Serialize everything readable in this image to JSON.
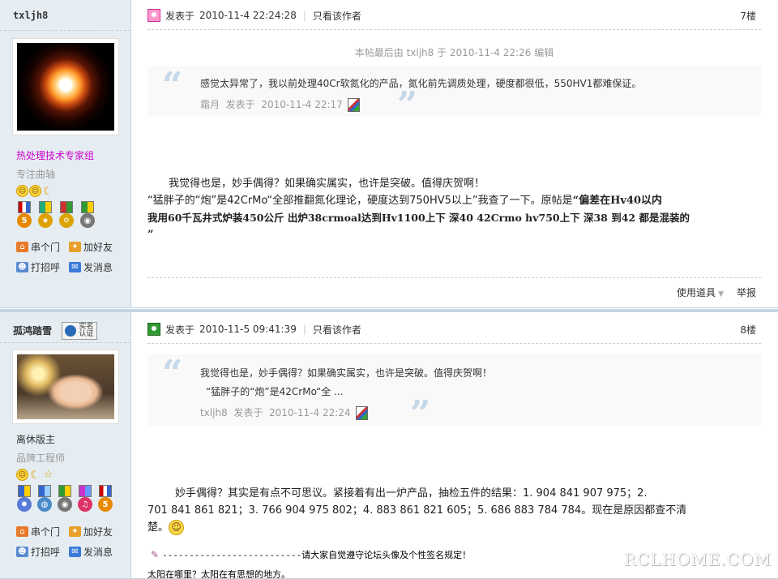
{
  "posts": [
    {
      "author": "txljh8",
      "group": "热处理技术专家组",
      "rank": "专注曲轴",
      "links": [
        "串个门",
        "加好友",
        "打招呼",
        "发消息"
      ],
      "posted_label": "发表于",
      "posted_time": "2010-11-4 22:24:28",
      "only_author": "只看该作者",
      "floor": "7楼",
      "edited": "本帖最后由 txljh8 于 2010-11-4 22:26 编辑",
      "quote": {
        "text": "感觉太异常了，我以前处理40Cr软氮化的产品，氮化前先调质处理，硬度都很低，550HV1都难保证。",
        "author": "霜月",
        "meta_label": "发表于",
        "time": "2010-11-4 22:17"
      },
      "body": {
        "line1": "我觉得也是，妙手偶得？如果确实属实，也许是突破。值得庆贺啊！",
        "line2_a": "“猛胖子的“炮”是42CrMo“全部推翻氮化理论，硬度达到750HV5以上”我查了一下。原帖是",
        "line2_b": "“偏差在Hv40以内",
        "line3": "我用60千瓦井式炉装450公斤  出炉38crmoal达到Hv1100上下  深40  42Crmo  hv750上下  深38  到42  都是混装的",
        "line4": "”"
      },
      "actions": [
        "使用道具",
        "举报"
      ]
    },
    {
      "author": "孤鸿踏雪",
      "verify_label_1": "实名",
      "verify_label_2": "认证",
      "group": "离休版主",
      "rank": "品牌工程师",
      "links": [
        "串个门",
        "加好友",
        "打招呼",
        "发消息"
      ],
      "posted_label": "发表于",
      "posted_time": "2010-11-5 09:41:39",
      "only_author": "只看该作者",
      "floor": "8楼",
      "quote": {
        "line1": "我觉得也是，妙手偶得？如果确实属实，也许是突破。值得庆贺啊！",
        "line2": "“猛胖子的“炮”是42CrMo“全 ...",
        "author": "txljh8",
        "meta_label": "发表于",
        "time": "2010-11-4 22:24"
      },
      "body": {
        "line1": "妙手偶得？其实是有点不可思议。紧接着有出一炉产品，抽检五件的结果：1. 904   841   907   975；2.",
        "line2": "701   841   861   821；3. 766   904   975   802；4. 883   861   821   605；5. 686   883   784   784。现在是原因都查不清",
        "line3": "楚。"
      },
      "signature": {
        "dashes": "--------------------------",
        "text": "请大家自觉遵守论坛头像及个性签名规定！",
        "line2": "太阳在哪里？太阳在有思想的地方。"
      }
    }
  ],
  "watermark": "RCLHOME.COM",
  "colors": {
    "sidebar_bg": "#e5edf2",
    "border": "#c2d5e3",
    "group_expert": "#cc00cc",
    "quote_mark": "#c5d8e9"
  }
}
